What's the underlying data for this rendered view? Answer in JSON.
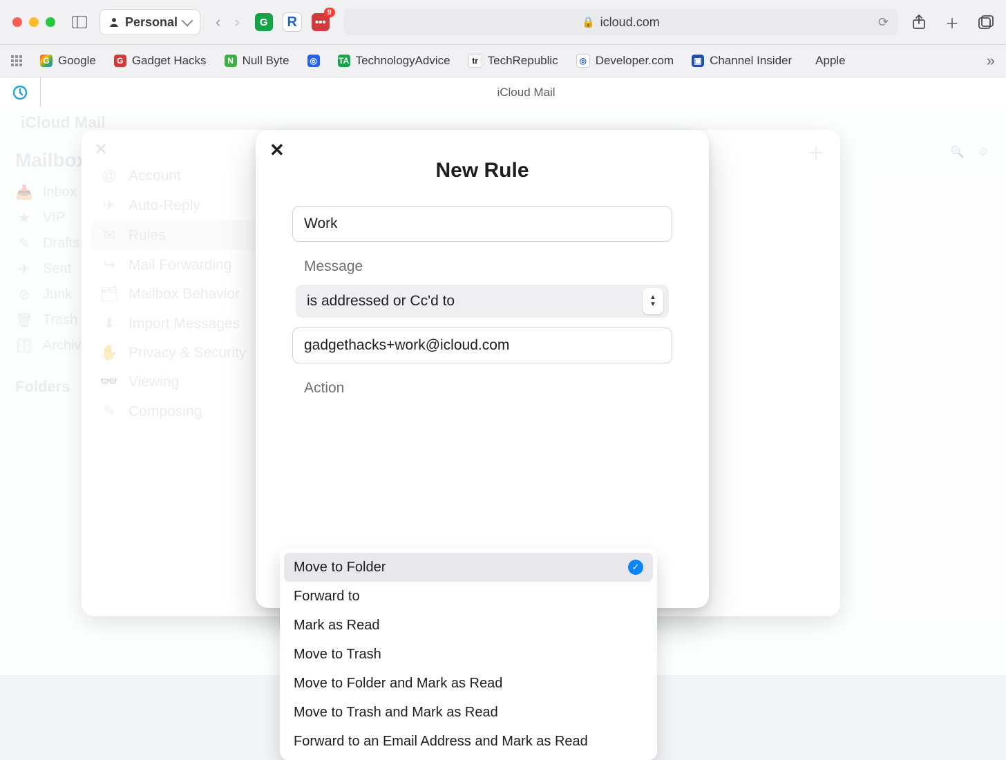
{
  "browser": {
    "profile_label": "Personal",
    "address": "icloud.com",
    "extension_badge": "9",
    "bookmarks": [
      {
        "label": "Google"
      },
      {
        "label": "Gadget Hacks"
      },
      {
        "label": "Null Byte"
      },
      {
        "label": "TechnologyAdvice"
      },
      {
        "label": "TechRepublic"
      },
      {
        "label": "Developer.com"
      },
      {
        "label": "Channel Insider"
      },
      {
        "label": "Apple"
      }
    ],
    "tab_title": "iCloud Mail"
  },
  "app": {
    "brand": "iCloud Mail",
    "mailboxes_title": "Mailboxes",
    "mailbox_items": [
      "Inbox",
      "VIP",
      "Drafts",
      "Sent",
      "Junk",
      "Trash",
      "Archive"
    ],
    "folders_title": "Folders"
  },
  "settings": {
    "items": [
      "Account",
      "Auto-Reply",
      "Rules",
      "Mail Forwarding",
      "Mailbox Behavior",
      "Import Messages",
      "Privacy & Security",
      "Viewing",
      "Composing"
    ],
    "selected_index": 2
  },
  "rule_modal": {
    "title": "New Rule",
    "name_value": "Work",
    "message_label": "Message",
    "condition_selected": "is addressed or Cc'd to",
    "condition_value": "gadgethacks+work@icloud.com",
    "action_label": "Action",
    "action_options": [
      "Move to Folder",
      "Forward to",
      "Mark as Read",
      "Move to Trash",
      "Move to Folder and Mark as Read",
      "Move to Trash and Mark as Read",
      "Forward to an Email Address and Mark as Read"
    ],
    "action_selected_index": 0
  }
}
